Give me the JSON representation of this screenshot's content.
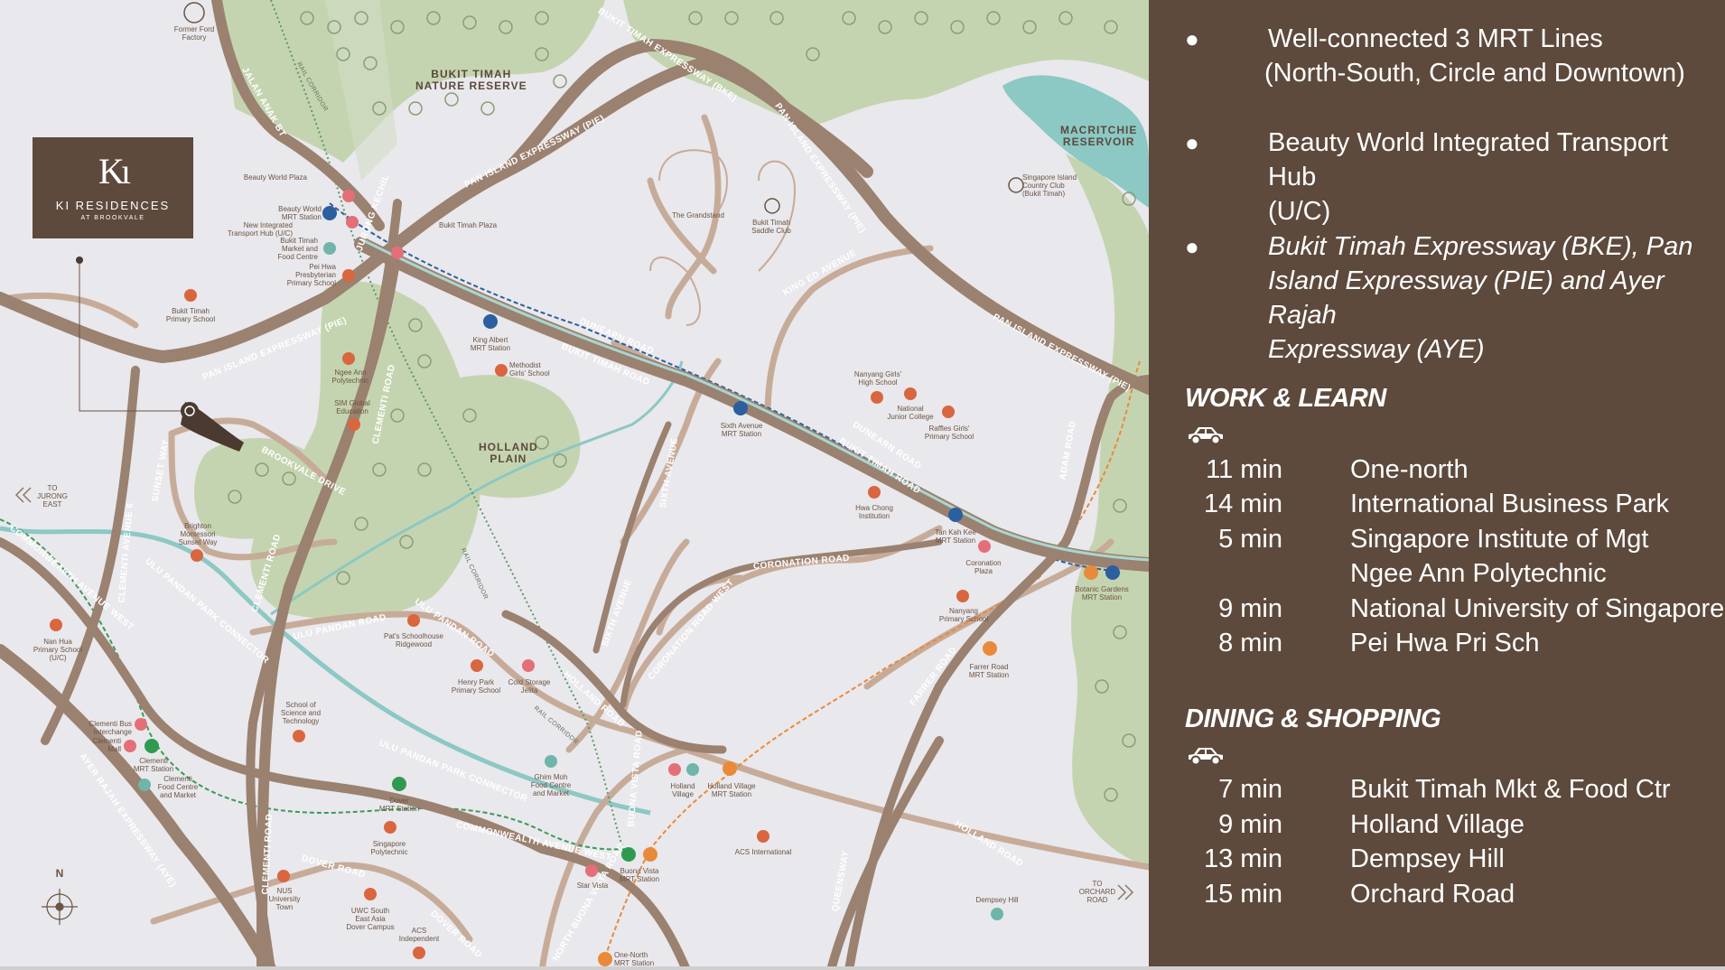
{
  "map": {
    "brand": {
      "mark": "Kı",
      "name": "KI RESIDENCES",
      "subtitle": "AT BROOKVALE"
    },
    "areas": [
      {
        "id": "bukit-timah-nature-reserve",
        "text": "BUKIT TIMAH\nNATURE RESERVE"
      },
      {
        "id": "macritchie-reservoir",
        "text": "MACRITCHIE\nRESERVOIR"
      },
      {
        "id": "holland-plain",
        "text": "HOLLAND\nPLAIN"
      }
    ],
    "roads": [
      "BUKIT TIMAH EXPRESSWAY (BKE)",
      "PAN ISLAND EXPRESSWAY (PIE)",
      "PAN ISLAND EXPRESSWAY (PIE)",
      "PAN ISLAND EXPRESSWAY (PIE)",
      "PAN ISLAND EXPRESSWAY (PIE)",
      "JALAN ANAK BT",
      "JURONG KECHIL",
      "DUNEARN ROAD",
      "BUKIT TIMAH ROAD",
      "DUNEARN ROAD",
      "BUKIT TIMAH ROAD",
      "CLEMENTI ROAD",
      "CLEMENTI ROAD",
      "CLEMENTI ROAD",
      "CLEMENTI AVENUE 6",
      "ULU PANDAN ROAD",
      "ULU PANDAN ROAD",
      "BROOKVALE DRIVE",
      "SUNSET WAY",
      "COMMONWEALTH AVENUE WEST",
      "COMMONWEALTH AVENUE WEST",
      "ULU PANDAN PARK CONNECTOR",
      "ULU PANDAN PARK CONNECTOR",
      "AYER RAJAH EXPRESSWAY (AYE)",
      "SIXTH AVENUE",
      "SIXTH AVENUE",
      "CORONATION ROAD",
      "CORONATION ROAD WEST",
      "HOLLAND ROAD",
      "HOLLAND ROAD",
      "FARRER ROAD",
      "ADAM ROAD",
      "QUEENSWAY",
      "DOVER ROAD",
      "DOVER ROAD",
      "NORTH BUONA VISTA ROAD",
      "BUONA VISTA ROAD",
      "KING ED AVENUE"
    ],
    "rail_labels": [
      "RAIL CORRIDOR",
      "RAIL CORRIDOR",
      "RAIL CORRIDOR"
    ],
    "places": [
      {
        "id": "former-ford-factory",
        "text": "Former Ford\nFactory"
      },
      {
        "id": "beauty-world-plaza",
        "text": "Beauty World Plaza"
      },
      {
        "id": "beauty-world-mrt",
        "text": "Beauty World\nMRT Station"
      },
      {
        "id": "new-integrated-transport-hub",
        "text": "New Integrated\nTransport Hub (U/C)"
      },
      {
        "id": "bukit-timah-market",
        "text": "Bukit Timah\nMarket and\nFood Centre"
      },
      {
        "id": "pei-hwa-presbyterian",
        "text": "Pei Hwa\nPresbyterian\nPrimary School"
      },
      {
        "id": "bukit-timah-plaza",
        "text": "Bukit Timah Plaza"
      },
      {
        "id": "bukit-timah-primary",
        "text": "Bukit Timah\nPrimary School"
      },
      {
        "id": "ngee-ann-poly",
        "text": "Ngee Ann\nPolytechnic"
      },
      {
        "id": "sim-global",
        "text": "SIM Global\nEducation"
      },
      {
        "id": "king-albert-mrt",
        "text": "King Albert\nMRT Station"
      },
      {
        "id": "methodist-girls",
        "text": "Methodist\nGirls' School"
      },
      {
        "id": "the-grandstand",
        "text": "The Grandstand"
      },
      {
        "id": "bukit-timah-saddle-club",
        "text": "Bukit Timah\nSaddle Club"
      },
      {
        "id": "singapore-island-country-club",
        "text": "Singapore Island\nCountry Club\n(Bukit Timah)"
      },
      {
        "id": "nanyang-girls",
        "text": "Nanyang Girls'\nHigh School"
      },
      {
        "id": "national-junior-college",
        "text": "National\nJunior College"
      },
      {
        "id": "raffles-girls",
        "text": "Raffles Girls'\nPrimary School"
      },
      {
        "id": "sixth-avenue-mrt",
        "text": "Sixth Avenue\nMRT Station"
      },
      {
        "id": "hwa-chong",
        "text": "Hwa Chong\nInstitution"
      },
      {
        "id": "tan-kah-kee-mrt",
        "text": "Tan Kah Kee\nMRT Station"
      },
      {
        "id": "coronation-plaza",
        "text": "Coronation\nPlaza"
      },
      {
        "id": "botanic-gardens-mrt",
        "text": "Botanic Gardens\nMRT Station"
      },
      {
        "id": "nanyang-primary",
        "text": "Nanyang\nPrimary School"
      },
      {
        "id": "farrer-road-mrt",
        "text": "Farrer Road\nMRT Station"
      },
      {
        "id": "to-jurong-east",
        "text": "TO\nJURONG\nEAST"
      },
      {
        "id": "brighton-montessori",
        "text": "Brighton\nMontessori\nSunset Way"
      },
      {
        "id": "nan-hua-primary",
        "text": "Nan Hua\nPrimary School\n(U/C)"
      },
      {
        "id": "pats-schoolhouse",
        "text": "Pat's Schoolhouse\nRidgewood"
      },
      {
        "id": "henry-park-primary",
        "text": "Henry Park\nPrimary School"
      },
      {
        "id": "cold-storage-jelita",
        "text": "Cold Storage\nJelita"
      },
      {
        "id": "clementi-bus-interchange",
        "text": "Clementi Bus\nInterchange"
      },
      {
        "id": "clementi-mall",
        "text": "Clementi\nMall"
      },
      {
        "id": "clementi-mrt",
        "text": "Clementi\nMRT Station"
      },
      {
        "id": "clementi-food-centre",
        "text": "Clementi\nFood Centre\nand Market"
      },
      {
        "id": "school-of-science",
        "text": "School of\nScience and\nTechnology"
      },
      {
        "id": "dover-mrt",
        "text": "Dover\nMRT Station"
      },
      {
        "id": "singapore-poly",
        "text": "Singapore\nPolytechnic"
      },
      {
        "id": "ghim-moh",
        "text": "Ghim Moh\nFood Centre\nand Market"
      },
      {
        "id": "holland-village",
        "text": "Holland\nVillage"
      },
      {
        "id": "holland-village-mrt",
        "text": "Holland Village\nMRT Station"
      },
      {
        "id": "acs-international",
        "text": "ACS International"
      },
      {
        "id": "nus-university-town",
        "text": "NUS\nUniversity\nTown"
      },
      {
        "id": "uwc-south-east-asia",
        "text": "UWC South\nEast Asia\nDover Campus"
      },
      {
        "id": "acs-independent",
        "text": "ACS\nIndependent"
      },
      {
        "id": "star-vista",
        "text": "Star Vista"
      },
      {
        "id": "buona-vista-mrt",
        "text": "Buona Vista\nMRT Station"
      },
      {
        "id": "one-north-mrt",
        "text": "One-North\nMRT Station"
      },
      {
        "id": "dempsey-hill",
        "text": "Dempsey Hill"
      },
      {
        "id": "to-orchard-road",
        "text": "TO\nORCHARD\nROAD"
      }
    ],
    "compass": "N"
  },
  "panel": {
    "bullets": [
      {
        "lines": [
          "Well-connected 3 MRT Lines",
          "(North-South, Circle and Downtown)"
        ],
        "italic": false
      },
      {
        "lines": [
          "Beauty World Integrated Transport Hub",
          "(U/C)"
        ],
        "italic": false
      },
      {
        "lines": [
          "Bukit Timah Expressway (BKE), Pan",
          "Island Expressway (PIE) and Ayer Rajah",
          "Expressway (AYE)"
        ],
        "italic": true
      }
    ],
    "work_learn": {
      "title": "WORK & LEARN",
      "rows": [
        {
          "time": "11 min",
          "dest": "One-north"
        },
        {
          "time": "14 min",
          "dest": "International Business Park"
        },
        {
          "time": "5 min",
          "dest": "Singapore Institute of Mgt"
        },
        {
          "time": "",
          "dest": "Ngee Ann Polytechnic"
        },
        {
          "time": "9 min",
          "dest": "National University of Singapore"
        },
        {
          "time": "8 min",
          "dest": "Pei Hwa Pri Sch"
        }
      ]
    },
    "dining_shopping": {
      "title": "DINING & SHOPPING",
      "rows": [
        {
          "time": "7 min",
          "dest": "Bukit Timah Mkt & Food Ctr"
        },
        {
          "time": "9 min",
          "dest": "Holland Village"
        },
        {
          "time": "13 min",
          "dest": "Dempsey Hill"
        },
        {
          "time": "15 min",
          "dest": "Orchard Road"
        }
      ]
    }
  },
  "colors": {
    "panel_bg": "#5d4a3d",
    "map_bg": "#e9e8ec",
    "green_area": "#c5d4b0",
    "expressway": "#9a8170",
    "minor_road": "#c7ab99",
    "water": "#8cc8c4",
    "mrt_blue": "#2b5f9e",
    "mrt_green": "#2f9a4f",
    "mrt_orange": "#e98a3a",
    "school": "#d9663f",
    "retail": "#e46f78",
    "food": "#6fb5aa"
  }
}
